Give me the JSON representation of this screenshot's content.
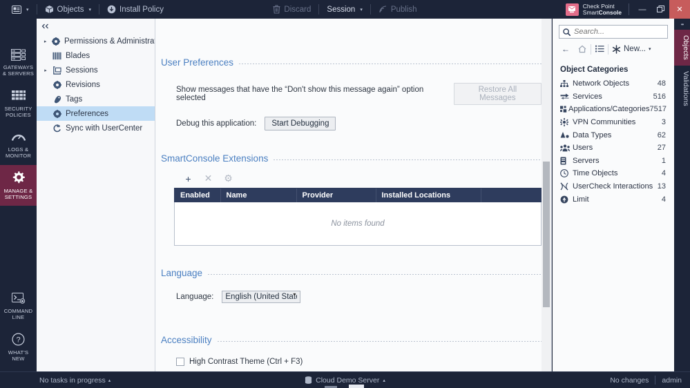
{
  "titlebar": {
    "app_menu_caret": "▾",
    "objects_label": "Objects",
    "objects_caret": "▾",
    "install_policy_label": "Install Policy",
    "discard_label": "Discard",
    "session_label": "Session",
    "session_caret": "▾",
    "publish_label": "Publish",
    "brand_line1": "Check Point",
    "brand_line2_light": "Smart",
    "brand_line2_bold": "Console",
    "minimize": "—",
    "restore": "❐",
    "close": "✕"
  },
  "rail": {
    "items": [
      {
        "name": "gateways-servers",
        "label": "GATEWAYS\n& SERVERS",
        "icon": "servers-icon",
        "active": false
      },
      {
        "name": "security-policies",
        "label": "SECURITY\nPOLICIES",
        "icon": "grid-icon",
        "active": false
      },
      {
        "name": "logs-monitor",
        "label": "LOGS &\nMONITOR",
        "icon": "gauge-icon",
        "active": false
      },
      {
        "name": "manage-settings",
        "label": "MANAGE &\nSETTINGS",
        "icon": "gear-icon",
        "active": true
      }
    ],
    "bottom_items": [
      {
        "name": "command-line",
        "label": "COMMAND\nLINE",
        "icon": "terminal-icon"
      },
      {
        "name": "whats-new",
        "label": "WHAT'S\nNEW",
        "icon": "question-circle-icon"
      }
    ]
  },
  "nav": {
    "collapse_glyph": "◄◄",
    "items": [
      {
        "label": "Permissions & Administrat...",
        "icon": "gear-icon",
        "expandable": true,
        "selected": false
      },
      {
        "label": "Blades",
        "icon": "blades-icon",
        "expandable": false,
        "selected": false
      },
      {
        "label": "Sessions",
        "icon": "sessions-icon",
        "expandable": true,
        "selected": false
      },
      {
        "label": "Revisions",
        "icon": "gear-icon",
        "expandable": false,
        "selected": false
      },
      {
        "label": "Tags",
        "icon": "tag-icon",
        "expandable": false,
        "selected": false
      },
      {
        "label": "Preferences",
        "icon": "gear-icon",
        "expandable": false,
        "selected": true
      },
      {
        "label": "Sync with UserCenter",
        "icon": "sync-icon",
        "expandable": false,
        "selected": false
      }
    ]
  },
  "main": {
    "user_preferences": {
      "title": "User Preferences",
      "restore_text": "Show messages that have the “Don't show this message again” option selected",
      "restore_button": "Restore All Messages",
      "debug_label": "Debug this application:",
      "debug_button": "Start Debugging"
    },
    "extensions": {
      "title": "SmartConsole Extensions",
      "toolbar": {
        "add": "+",
        "remove": "✕",
        "settings": "⚙"
      },
      "columns": [
        "Enabled",
        "Name",
        "Provider",
        "Installed Locations",
        ""
      ],
      "rows": [],
      "empty_text": "No items found"
    },
    "language": {
      "title": "Language",
      "label": "Language:",
      "value": "English (United States)",
      "options": [
        "English (United States)"
      ]
    },
    "accessibility": {
      "title": "Accessibility",
      "high_contrast_label": "High Contrast Theme (Ctrl + F3)",
      "high_contrast_checked": false
    }
  },
  "objects_panel": {
    "search_placeholder": "Search...",
    "search_value": "",
    "toolbar": {
      "back": "←",
      "home": "⌂",
      "list": "≣",
      "new_label": "New...",
      "new_caret": "▾"
    },
    "categories_title": "Object Categories",
    "categories": [
      {
        "label": "Network Objects",
        "count": "48",
        "icon": "network-icon"
      },
      {
        "label": "Services",
        "count": "516",
        "icon": "services-icon"
      },
      {
        "label": "Applications/Categories",
        "count": "7517",
        "icon": "apps-icon"
      },
      {
        "label": "VPN Communities",
        "count": "3",
        "icon": "vpn-icon"
      },
      {
        "label": "Data Types",
        "count": "62",
        "icon": "data-types-icon"
      },
      {
        "label": "Users",
        "count": "27",
        "icon": "users-icon"
      },
      {
        "label": "Servers",
        "count": "1",
        "icon": "server-icon"
      },
      {
        "label": "Time Objects",
        "count": "4",
        "icon": "clock-icon"
      },
      {
        "label": "UserCheck Interactions",
        "count": "13",
        "icon": "usercheck-icon"
      },
      {
        "label": "Limit",
        "count": "4",
        "icon": "limit-icon"
      }
    ]
  },
  "vtabs": {
    "dots": "••",
    "items": [
      {
        "label": "Objects",
        "active": true
      },
      {
        "label": "Validations",
        "active": false
      }
    ]
  },
  "statusbar": {
    "tasks_label": "No tasks in progress",
    "tasks_caret": "▴",
    "server_label": "Cloud Demo Server",
    "server_caret": "▴",
    "changes_label": "No changes",
    "user_label": "admin"
  },
  "colors": {
    "chrome": "#1c2438",
    "accent_maroon": "#6e2746",
    "section_blue": "#4a7fc1",
    "table_header": "#2e3c5d",
    "selection_blue": "#bfdcf5",
    "close_red": "#c75c5c"
  }
}
